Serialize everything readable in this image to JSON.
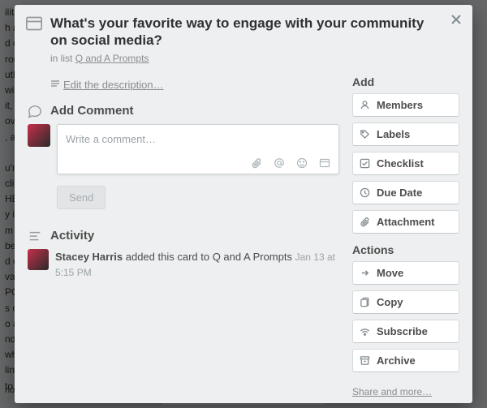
{
  "card": {
    "title": "What's your favorite way to engage with your community on social media?",
    "in_list_prefix": "in list ",
    "list_name": "Q and A Prompts"
  },
  "edit_description": "Edit the description…",
  "sections": {
    "add_comment": "Add Comment",
    "activity": "Activity"
  },
  "comment": {
    "placeholder": "Write a comment…",
    "send_label": "Send"
  },
  "activity": {
    "user": "Stacey Harris",
    "action": " added this card to Q and A Prompts ",
    "time": "Jan 13 at 5:15 PM"
  },
  "sidebar": {
    "add_title": "Add",
    "add_items": {
      "members": "Members",
      "labels": "Labels",
      "checklist": "Checklist",
      "due_date": "Due Date",
      "attachment": "Attachment"
    },
    "actions_title": "Actions",
    "action_items": {
      "move": "Move",
      "copy": "Copy",
      "subscribe": "Subscribe",
      "archive": "Archive"
    },
    "share_more": "Share and more…"
  }
}
